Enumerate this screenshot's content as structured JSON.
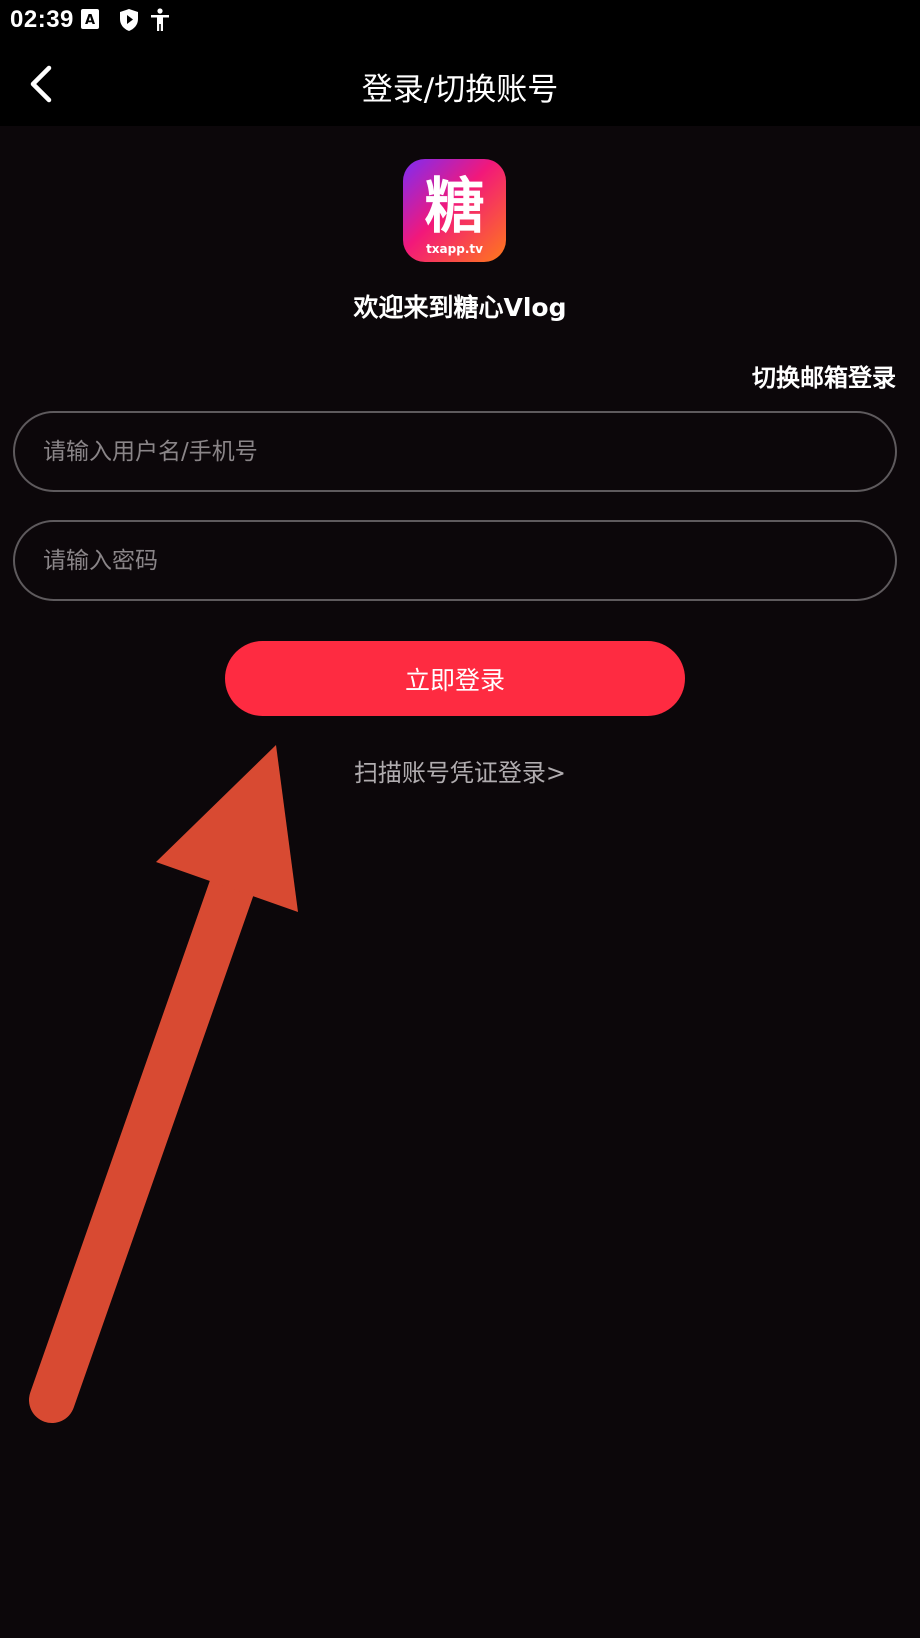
{
  "status_bar": {
    "time": "02:39",
    "icons": [
      "a-notification-icon",
      "shield-play-icon",
      "accessibility-icon"
    ]
  },
  "nav": {
    "title": "登录/切换账号",
    "back_icon": "chevron-left-icon"
  },
  "app": {
    "logo_char": "糖",
    "logo_domain": "txapp.tv",
    "welcome": "欢迎来到糖心Vlog"
  },
  "form": {
    "switch_email_label": "切换邮箱登录",
    "username_placeholder": "请输入用户名/手机号",
    "username_value": "",
    "password_placeholder": "请输入密码",
    "password_value": "",
    "login_label": "立即登录",
    "scan_label": "扫描账号凭证登录>"
  },
  "colors": {
    "primary_button": "#fe2b41",
    "background": "#0c070a",
    "annotation_arrow": "#d84a32"
  }
}
